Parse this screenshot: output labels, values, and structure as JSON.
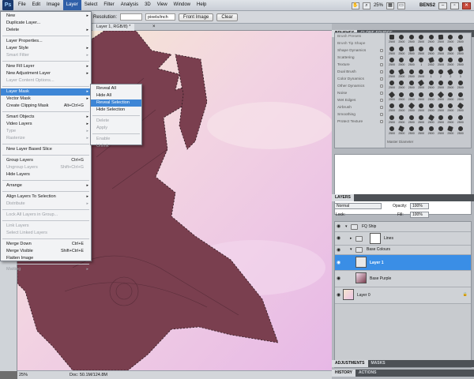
{
  "app": {
    "logo": "Ps",
    "menus": [
      "File",
      "Edit",
      "Image",
      "Layer",
      "Select",
      "Filter",
      "Analysis",
      "3D",
      "View",
      "Window",
      "Help"
    ],
    "active_menu": "Layer",
    "zoom_display": "25%",
    "workspace": "BENS2"
  },
  "options_bar": {
    "resolution_label": "Resolution:",
    "resolution_unit": "pixels/inch",
    "front_image_label": "Front Image",
    "clear_label": "Clear"
  },
  "document": {
    "tab_title": "Layer 1, RGB/8) *",
    "tab_close": "×",
    "status_zoom": "25%",
    "status_doc": "Doc: 50.1M/124.8M"
  },
  "layer_menu": [
    {
      "label": "New",
      "arrow": "▸"
    },
    {
      "label": "Duplicate Layer..."
    },
    {
      "label": "Delete",
      "arrow": "▸"
    },
    {
      "sep": true
    },
    {
      "label": "Layer Properties..."
    },
    {
      "label": "Layer Style",
      "arrow": "▸"
    },
    {
      "label": "Smart Filter",
      "disabled": true,
      "arrow": "▸"
    },
    {
      "sep": true
    },
    {
      "label": "New Fill Layer",
      "arrow": "▸"
    },
    {
      "label": "New Adjustment Layer",
      "arrow": "▸"
    },
    {
      "label": "Layer Content Options...",
      "disabled": true
    },
    {
      "sep": true
    },
    {
      "label": "Layer Mask",
      "arrow": "▸",
      "highlight": true
    },
    {
      "label": "Vector Mask",
      "arrow": "▸"
    },
    {
      "label": "Create Clipping Mask",
      "shortcut": "Alt+Ctrl+G"
    },
    {
      "sep": true
    },
    {
      "label": "Smart Objects",
      "arrow": "▸"
    },
    {
      "label": "Video Layers",
      "arrow": "▸"
    },
    {
      "label": "Type",
      "disabled": true,
      "arrow": "▸"
    },
    {
      "label": "Rasterize",
      "disabled": true,
      "arrow": "▸"
    },
    {
      "sep": true
    },
    {
      "label": "New Layer Based Slice"
    },
    {
      "sep": true
    },
    {
      "label": "Group Layers",
      "shortcut": "Ctrl+G"
    },
    {
      "label": "Ungroup Layers",
      "shortcut": "Shift+Ctrl+G",
      "disabled": true
    },
    {
      "label": "Hide Layers"
    },
    {
      "sep": true
    },
    {
      "label": "Arrange",
      "arrow": "▸"
    },
    {
      "sep": true
    },
    {
      "label": "Align Layers To Selection",
      "arrow": "▸"
    },
    {
      "label": "Distribute",
      "disabled": true,
      "arrow": "▸"
    },
    {
      "sep": true
    },
    {
      "label": "Lock All Layers in Group...",
      "disabled": true
    },
    {
      "sep": true
    },
    {
      "label": "Link Layers",
      "disabled": true
    },
    {
      "label": "Select Linked Layers",
      "disabled": true
    },
    {
      "sep": true
    },
    {
      "label": "Merge Down",
      "shortcut": "Ctrl+E"
    },
    {
      "label": "Merge Visible",
      "shortcut": "Shift+Ctrl+E"
    },
    {
      "label": "Flatten Image"
    },
    {
      "sep": true
    },
    {
      "label": "Matting",
      "disabled": true,
      "arrow": "▸"
    }
  ],
  "mask_submenu": [
    {
      "label": "Reveal All"
    },
    {
      "label": "Hide All"
    },
    {
      "label": "Reveal Selection",
      "highlight": true
    },
    {
      "label": "Hide Selection"
    },
    {
      "sep": true
    },
    {
      "label": "Delete",
      "disabled": true
    },
    {
      "label": "Apply",
      "disabled": true
    },
    {
      "sep": true
    },
    {
      "label": "Enable",
      "disabled": true
    },
    {
      "label": "Unlink",
      "disabled": true
    }
  ],
  "brushes_panel": {
    "tabs": [
      "BRUSHES",
      "CLONE SOURCE"
    ],
    "options": [
      "Brush Presets",
      "Brush Tip Shape",
      "Shape Dynamics",
      "Scattering",
      "Texture",
      "Dual Brush",
      "Color Dynamics",
      "Other Dynamics",
      "Noise",
      "Wet Edges",
      "Airbrush",
      "Smoothing",
      "Protect Texture"
    ],
    "master_label": "Master Diameter",
    "sizes": [
      "2500",
      "2500",
      "2500",
      "2500",
      "2500",
      "2500",
      "2500",
      "2500",
      "2500",
      "2500",
      "2500",
      "2500",
      "2500",
      "2500",
      "2500",
      "2500",
      "2500",
      "2500",
      "2500",
      "1",
      "2452",
      "2500",
      "2500",
      "2500",
      "2500",
      "2500",
      "2500",
      "2500",
      "1",
      "2",
      "2",
      "3",
      "2500",
      "2500",
      "2500",
      "2500",
      "2500",
      "2500",
      "2500",
      "2500",
      "2500",
      "2500",
      "2500",
      "2500",
      "2500",
      "2500",
      "2500",
      "2500",
      "2500",
      "2500",
      "2500",
      "2500",
      "2500",
      "2500",
      "2500",
      "2500",
      "2500",
      "2500",
      "2500",
      "2500",
      "2500",
      "2500",
      "2500",
      "2500",
      "2500",
      "2500",
      "2500",
      "2500",
      "2500",
      "2500",
      "2500",
      "2500"
    ]
  },
  "layers_panel": {
    "tab": "LAYERS",
    "blend_mode": "Normal",
    "opacity_label": "Opacity:",
    "opacity": "100%",
    "lock_label": "Lock:",
    "fill_label": "Fill:",
    "fill": "100%",
    "layers": [
      {
        "name": "FQ Ship",
        "type": "group"
      },
      {
        "name": "Lines",
        "type": "group"
      },
      {
        "name": "Base Colours",
        "type": "group"
      },
      {
        "name": "Layer 1",
        "type": "layer",
        "selected": true
      },
      {
        "name": "Base Purple",
        "type": "layer"
      },
      {
        "name": "Layer 0",
        "type": "layer",
        "locked": true
      }
    ]
  },
  "bottom_tabs": {
    "adjustments": [
      "ADJUSTMENTS",
      "MASKS"
    ],
    "history": [
      "HISTORY",
      "ACTIONS"
    ]
  },
  "colors": {
    "selection_blue": "#3a8ee6",
    "menu_highlight": "#3e86d6",
    "ship_mask": "#7a3f4f"
  }
}
